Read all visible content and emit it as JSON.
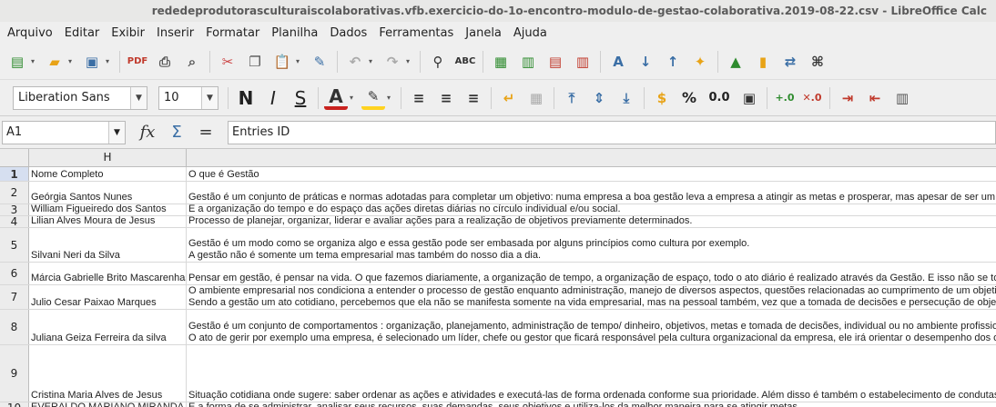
{
  "window": {
    "title": "rededeprodutorasculturaiscolaborativas.vfb.exercicio-do-1o-encontro-modulo-de-gestao-colaborativa.2019-08-22.csv - LibreOffice Calc"
  },
  "menu": [
    "Arquivo",
    "Editar",
    "Exibir",
    "Inserir",
    "Formatar",
    "Planilha",
    "Dados",
    "Ferramentas",
    "Janela",
    "Ajuda"
  ],
  "standard_toolbar": [
    "new-icon",
    "open-icon",
    "save-icon",
    "pdf-icon",
    "print-icon",
    "print-preview-icon",
    "cut-icon",
    "copy-icon",
    "paste-icon",
    "clone-formatting-icon",
    "undo-icon",
    "redo-icon",
    "find-replace-icon",
    "spelling-icon",
    "row-icon",
    "column-icon",
    "insert-row-icon",
    "insert-column-icon",
    "sort-icon",
    "sort-asc-icon",
    "sort-desc-icon",
    "autofilter-icon",
    "image-icon",
    "chart-icon",
    "pivot-icon",
    "special-char-icon"
  ],
  "format_toolbar": {
    "font_name": "Liberation Sans",
    "font_size": "10",
    "bold": "N",
    "italic": "I",
    "underline": "S",
    "font_color_letter": "A",
    "percent": "%",
    "number_format": "0.0"
  },
  "formula_bar": {
    "name_box": "A1",
    "content": "Entries ID"
  },
  "sheet": {
    "column_label": "H",
    "rows": [
      {
        "num": "1",
        "h": "Nome Completo",
        "i": [
          "O que é Gestão"
        ],
        "height": 15,
        "active": true
      },
      {
        "num": "2",
        "h": "Geórgia Santos Nunes",
        "i": [
          "Gestão é um conjunto de práticas e normas adotadas para completar um objetivo: numa empresa a boa gestão leva a empresa a atingir as metas e prosperar, mas apesar de ser um f"
        ],
        "height": 24
      },
      {
        "num": "3",
        "h": "William Figueiredo dos Santos",
        "i": [
          "É a organização do tempo e do espaço das ações diretas diárias no círculo individual e/ou social."
        ],
        "height": 12
      },
      {
        "num": "4",
        "h": "Lilian Alves Moura de Jesus",
        "i": [
          "Processo de planejar, organizar, liderar e avaliar ações para a realização de objetivos previamente determinados."
        ],
        "height": 12
      },
      {
        "num": "5",
        "h": "Silvani Neri da Silva",
        "i": [
          "Gestão é um modo como se organiza algo e essa gestão pode ser embasada por alguns princípios como cultura por exemplo.",
          "A gestão não é somente um tema empresarial mas também do nosso dia a dia."
        ],
        "height": 37
      },
      {
        "num": "6",
        "h": "Márcia Gabrielle Brito Mascarenhas",
        "i": [
          "Pensar em gestão, é pensar na vida. O que fazemos diariamente, a organização de tempo, a organização de espaço, todo o ato diário é realizado através da Gestão. E isso não se to"
        ],
        "height": 24
      },
      {
        "num": "7",
        "h": "Julio Cesar Paixao Marques",
        "i": [
          "O ambiente empresarial nos condiciona a entender o processo de gestão enquanto administração, manejo de diversos aspectos, questões relacionadas ao cumprimento de um objetiv",
          "Sendo a gestão um ato cotidiano, percebemos que ela não se manifesta somente na vida empresarial, mas na pessoal também, vez que a tomada de decisões e persecução de objetiv"
        ],
        "height": 26
      },
      {
        "num": "8",
        "h": "Juliana Geiza Ferreira da silva",
        "i": [
          "Gestão é um conjunto de comportamentos : organização, planejamento, administração de tempo/ dinheiro, objetivos, metas e tomada de decisões, individual ou no ambiente profissional",
          "O ato de gerir por exemplo uma empresa, é selecionado um líder, chefe ou gestor que ficará responsável pela cultura organizacional da empresa, ele irá orientar o desempenho dos ou"
        ],
        "height": 38
      },
      {
        "num": "9",
        "h": "Cristina Maria Alves de Jesus",
        "i": [
          "Situação cotidiana onde sugere: saber ordenar as ações e atividades e executá-las de forma ordenada conforme sua prioridade. Além disso é também o estabelecimento de condutas"
        ],
        "height": 62
      },
      {
        "num": "10",
        "h": "EVERALDO MARIANO MIRANDA",
        "i": [
          "É a forma de se administrar, analisar seus recursos, suas demandas, seus objetivos e utiliza-los da melhor maneira para se atingir metas."
        ],
        "height": 12
      }
    ]
  }
}
